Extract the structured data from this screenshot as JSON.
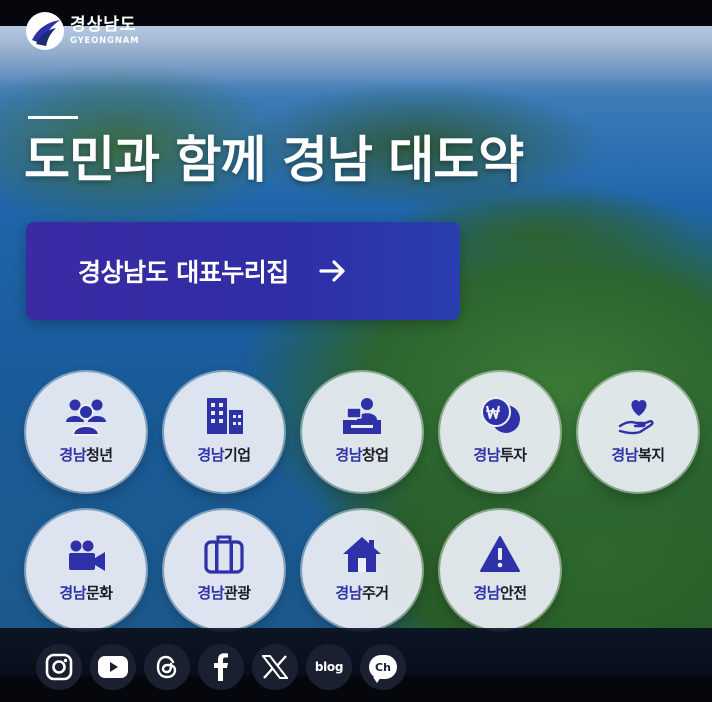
{
  "brand": {
    "name_ko": "경상남도",
    "name_en": "GYEONGNAM"
  },
  "hero": {
    "headline": "도민과 함께 경남 대도약"
  },
  "cta": {
    "label": "경상남도 대표누리집",
    "icon": "arrow-right-icon"
  },
  "menu": [
    {
      "prefix": "경남",
      "suffix": "청년",
      "icon": "people-icon"
    },
    {
      "prefix": "경남",
      "suffix": "기업",
      "icon": "building-icon"
    },
    {
      "prefix": "경남",
      "suffix": "창업",
      "icon": "startup-desk-icon"
    },
    {
      "prefix": "경남",
      "suffix": "투자",
      "icon": "coin-won-icon"
    },
    {
      "prefix": "경남",
      "suffix": "복지",
      "icon": "heart-hand-icon"
    },
    {
      "prefix": "경남",
      "suffix": "문화",
      "icon": "video-camera-icon"
    },
    {
      "prefix": "경남",
      "suffix": "관광",
      "icon": "suitcase-icon"
    },
    {
      "prefix": "경남",
      "suffix": "주거",
      "icon": "house-icon"
    },
    {
      "prefix": "경남",
      "suffix": "안전",
      "icon": "warning-icon"
    }
  ],
  "social": [
    {
      "name": "instagram-icon"
    },
    {
      "name": "youtube-icon"
    },
    {
      "name": "threads-icon"
    },
    {
      "name": "facebook-icon"
    },
    {
      "name": "x-icon"
    },
    {
      "name": "blog-icon",
      "text": "blog"
    },
    {
      "name": "channel-icon",
      "text": "Ch"
    }
  ],
  "colors": {
    "accent": "#2f31a8",
    "cta_bg": "#3a2aa3",
    "circle_bg": "#eceff6",
    "social_bg": "#1a2030"
  }
}
